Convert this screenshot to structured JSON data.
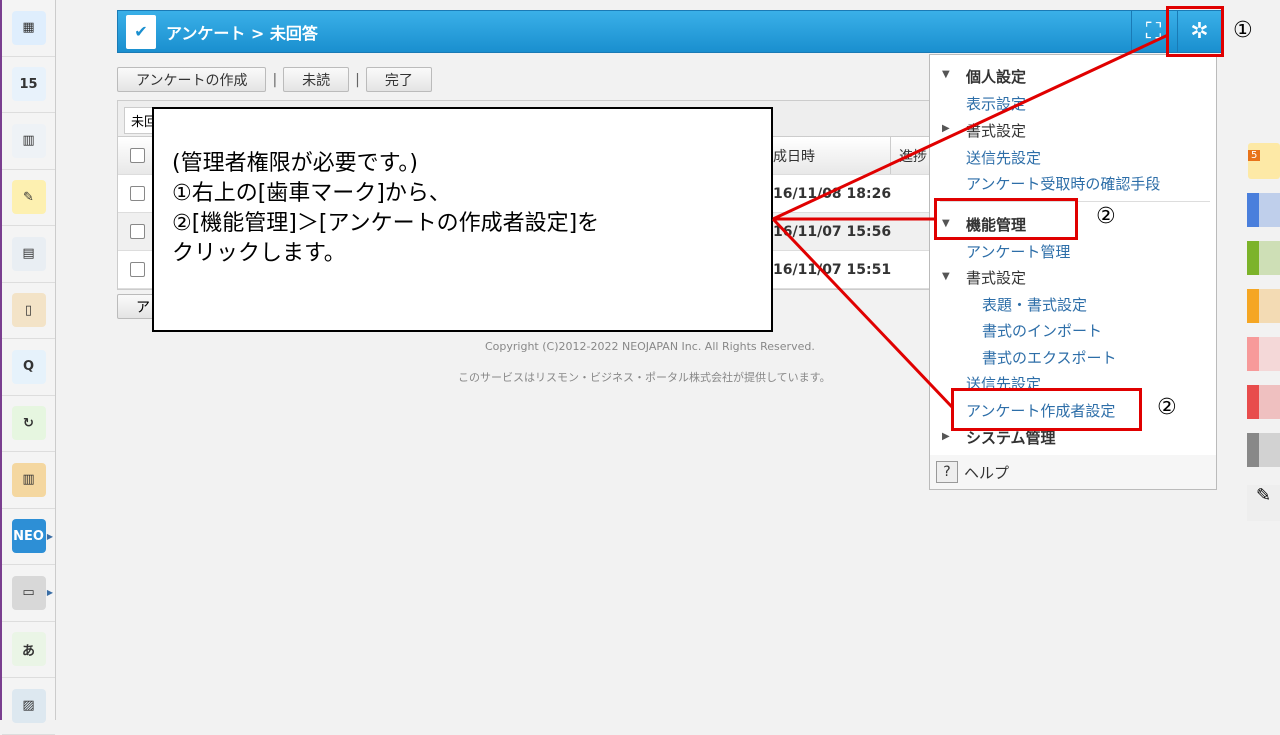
{
  "sidebar": {
    "items": [
      {
        "icon": "portal-icon",
        "label": "▦"
      },
      {
        "icon": "calendar-icon",
        "label": "15"
      },
      {
        "icon": "facility-icon",
        "label": "▥"
      },
      {
        "icon": "memo-icon",
        "label": "✎"
      },
      {
        "icon": "bulletin-board-icon",
        "label": "▤"
      },
      {
        "icon": "clipboard-icon",
        "label": "▯"
      },
      {
        "icon": "survey-icon",
        "label": "Q"
      },
      {
        "icon": "workflow-icon",
        "label": "↻"
      },
      {
        "icon": "cabinet-icon",
        "label": "▥"
      },
      {
        "icon": "neo-icon",
        "label": "NEO"
      },
      {
        "icon": "folder-icon",
        "label": "▭"
      },
      {
        "icon": "app-icon",
        "label": "あ"
      },
      {
        "icon": "photo-icon",
        "label": "▨"
      }
    ]
  },
  "header": {
    "title": "アンケート > 未回答",
    "fullscreen_icon": "fullscreen-icon",
    "gear_icon": "gear-icon"
  },
  "toolbar": {
    "create": "アンケートの作成",
    "sep": "|",
    "unread": "未読",
    "done": "完了"
  },
  "filter": {
    "value": "未回"
  },
  "table": {
    "headers": {
      "date": "成日時",
      "progress": "進捗"
    },
    "rows": [
      {
        "date": "16/11/08 18:26"
      },
      {
        "date": "16/11/07 15:56"
      },
      {
        "date": "16/11/07 15:51"
      }
    ]
  },
  "bottom_button": "ア",
  "footer": {
    "copyright": "Copyright (C)2012-2022 NEOJAPAN Inc. All Rights Reserved.",
    "provider": "このサービスはリスモン・ビジネス・ポータル株式会社が提供しています。"
  },
  "callout": {
    "lines": [
      "(管理者権限が必要です。)",
      "①右上の[歯車マーク]から、",
      "②[機能管理]＞[アンケートの作成者設定]を",
      "クリックします。"
    ]
  },
  "menu": {
    "personal": "個人設定",
    "display": "表示設定",
    "format": "書式設定",
    "destination": "送信先設定",
    "confirm": "アンケート受取時の確認手段",
    "function_mgmt": "機能管理",
    "survey_mgmt": "アンケート管理",
    "format2": "書式設定",
    "title_format": "表題・書式設定",
    "import": "書式のインポート",
    "export": "書式のエクスポート",
    "destination2": "送信先設定",
    "creator": "アンケート作成者設定",
    "system": "システム管理",
    "help": "ヘルプ"
  },
  "annotations": {
    "n1": "①",
    "n2a": "②",
    "n2b": "②"
  },
  "colors": {
    "accent": "#1a8fcf",
    "highlight": "#e00000",
    "swatches": [
      "#4a7fdc",
      "#7cb32a",
      "#f5a623",
      "#f79a9a",
      "#e84c4c",
      "#888888"
    ]
  }
}
